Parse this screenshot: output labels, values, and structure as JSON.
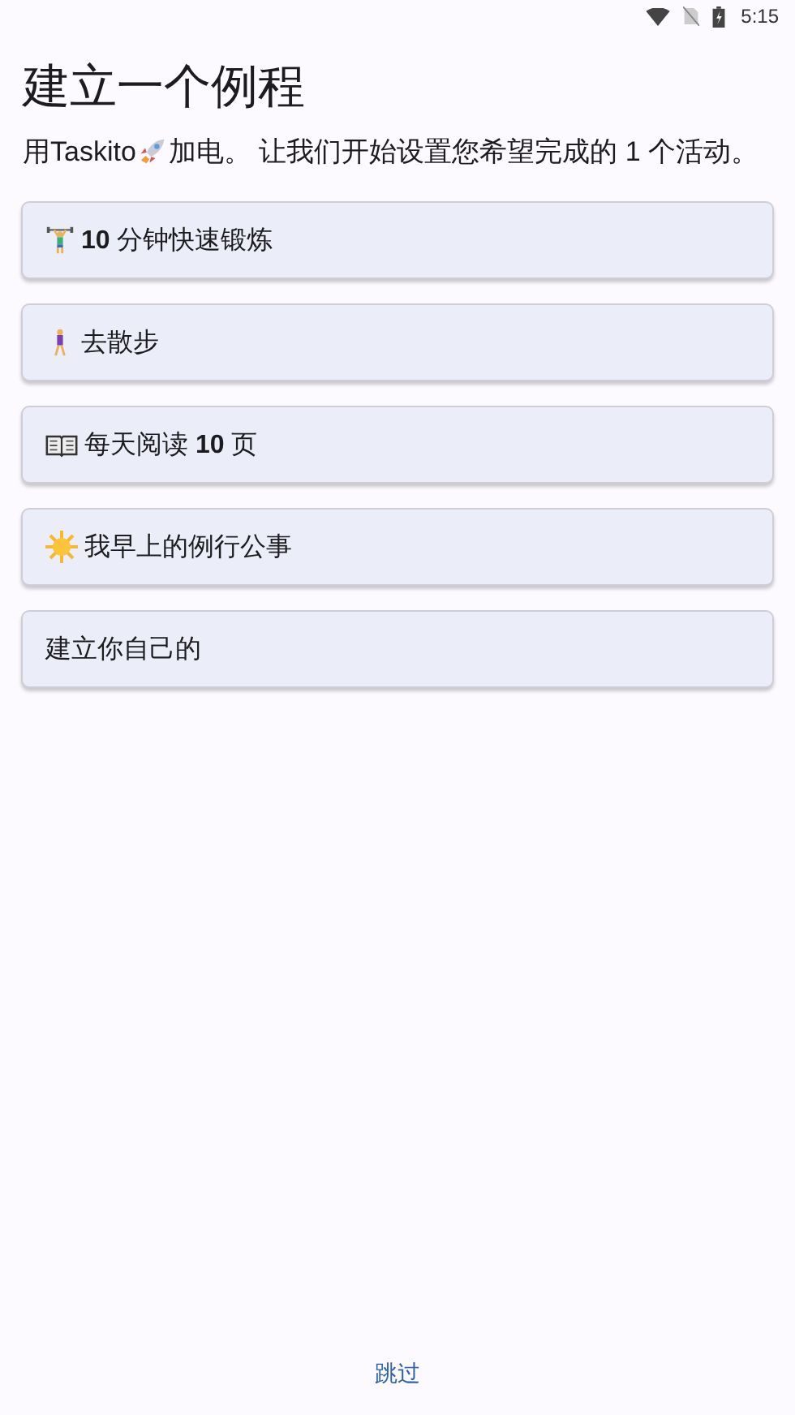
{
  "status_bar": {
    "time": "5:15"
  },
  "title": "建立一个例程",
  "intro": {
    "before": "用Taskito",
    "after": "加电。 让我们开始设置您希望完成的 1 个活动。"
  },
  "routines": [
    {
      "kind": "weightlifter",
      "label": "**10** 分钟快速锻炼"
    },
    {
      "kind": "walker",
      "label": "去散步"
    },
    {
      "kind": "book",
      "label": "每天阅读 **10** 页"
    },
    {
      "kind": "sun",
      "label": "我早上的例行公事"
    },
    {
      "kind": "plain",
      "label": "建立你自己的"
    }
  ],
  "skip_link": "跳过"
}
